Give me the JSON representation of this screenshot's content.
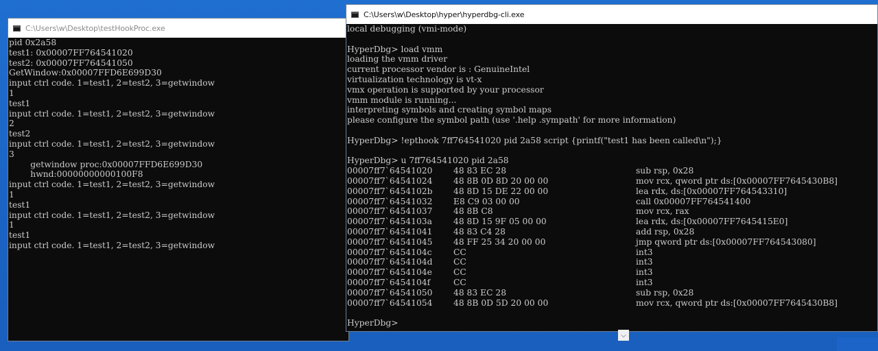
{
  "left_window": {
    "title": "C:\\Users\\w\\Desktop\\testHookProc.exe",
    "lines": [
      "pid 0x2a58",
      "test1: 0x00007FF764541020",
      "test2: 0x00007FF764541050",
      "GetWindow:0x00007FFD6E699D30",
      "input ctrl code. 1=test1, 2=test2, 3=getwindow",
      "1",
      "test1",
      "input ctrl code. 1=test1, 2=test2, 3=getwindow",
      "2",
      "test2",
      "input ctrl code. 1=test1, 2=test2, 3=getwindow",
      "3",
      "        getwindow proc:0x00007FFD6E699D30",
      "        hwnd:00000000000100F8",
      "input ctrl code. 1=test1, 2=test2, 3=getwindow",
      "1",
      "test1",
      "input ctrl code. 1=test1, 2=test2, 3=getwindow",
      "1",
      "test1",
      "input ctrl code. 1=test1, 2=test2, 3=getwindow"
    ]
  },
  "right_window": {
    "title": "C:\\Users\\w\\Desktop\\hyper\\hyperdbg-cli.exe",
    "lines_before": [
      "local debugging (vmi-mode)",
      "",
      "HyperDbg> load vmm",
      "loading the vmm driver",
      "current processor vendor is : GenuineIntel",
      "virtualization technology is vt-x",
      "vmx operation is supported by your processor",
      "vmm module is running...",
      "interpreting symbols and creating symbol maps",
      "please configure the symbol path (use '.help .sympath' for more information)",
      "",
      "HyperDbg> !epthook 7ff764541020 pid 2a58 script {printf(\"test1 has been called\\n\");}",
      "",
      "HyperDbg> u 7ff764541020 pid 2a58"
    ],
    "disassembly": [
      {
        "addr": "00007ff7`64541020",
        "bytes": "48 83 EC 28",
        "instr": "sub rsp, 0x28"
      },
      {
        "addr": "00007ff7`64541024",
        "bytes": "48 8B 0D 8D 20 00 00",
        "instr": "mov rcx, qword ptr ds:[0x00007FF7645430B8]"
      },
      {
        "addr": "00007ff7`6454102b",
        "bytes": "48 8D 15 DE 22 00 00",
        "instr": "lea rdx, ds:[0x00007FF764543310]"
      },
      {
        "addr": "00007ff7`64541032",
        "bytes": "E8 C9 03 00 00",
        "instr": "call 0x00007FF764541400"
      },
      {
        "addr": "00007ff7`64541037",
        "bytes": "48 8B C8",
        "instr": "mov rcx, rax"
      },
      {
        "addr": "00007ff7`6454103a",
        "bytes": "48 8D 15 9F 05 00 00",
        "instr": "lea rdx, ds:[0x00007FF7645415E0]"
      },
      {
        "addr": "00007ff7`64541041",
        "bytes": "48 83 C4 28",
        "instr": "add rsp, 0x28"
      },
      {
        "addr": "00007ff7`64541045",
        "bytes": "48 FF 25 34 20 00 00",
        "instr": "jmp qword ptr ds:[0x00007FF764543080]"
      },
      {
        "addr": "00007ff7`6454104c",
        "bytes": "CC",
        "instr": "int3"
      },
      {
        "addr": "00007ff7`6454104d",
        "bytes": "CC",
        "instr": "int3"
      },
      {
        "addr": "00007ff7`6454104e",
        "bytes": "CC",
        "instr": "int3"
      },
      {
        "addr": "00007ff7`6454104f",
        "bytes": "CC",
        "instr": "int3"
      },
      {
        "addr": "00007ff7`64541050",
        "bytes": "48 83 EC 28",
        "instr": "sub rsp, 0x28"
      },
      {
        "addr": "00007ff7`64541054",
        "bytes": "48 8B 0D 5D 20 00 00",
        "instr": "mov rcx, qword ptr ds:[0x00007FF7645430B8]"
      }
    ],
    "lines_after": [
      "",
      "HyperDbg>"
    ]
  },
  "icons": {
    "console_app": "console-app-icon",
    "scroll_down": "chevron-down-icon"
  },
  "colors": {
    "console_bg": "#0c0c0c",
    "console_fg": "#cccccc",
    "desktop": "#1b64c4"
  }
}
